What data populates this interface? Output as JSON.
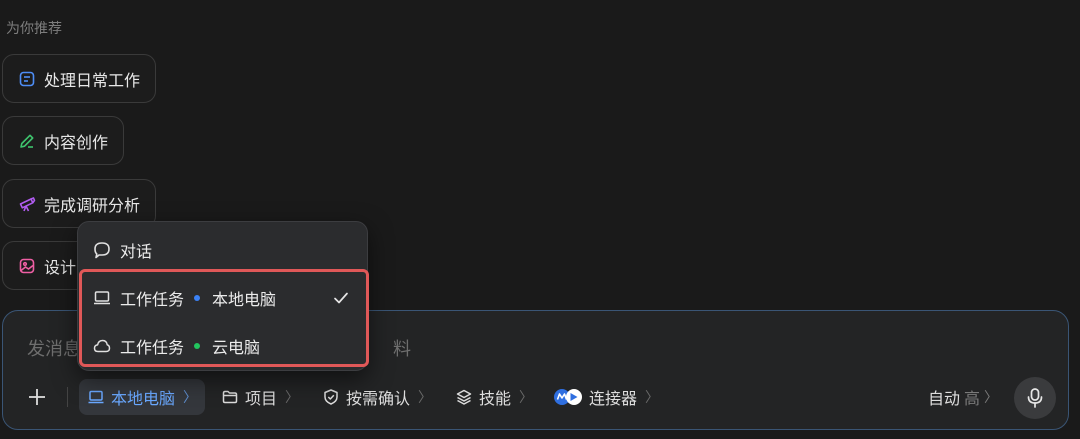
{
  "recommend": {
    "label": "为你推荐",
    "chips": [
      {
        "label": "处理日常工作",
        "icon": "checklist-icon",
        "color": "#4e8ef7"
      },
      {
        "label": "内容创作",
        "icon": "pen-icon",
        "color": "#3ec46d"
      },
      {
        "label": "完成调研分析",
        "icon": "telescope-icon",
        "color": "#b05cf0"
      },
      {
        "label": "设计",
        "icon": "image-icon",
        "color": "#ef5fa4"
      }
    ]
  },
  "menu": {
    "items": [
      {
        "label": "对话",
        "icon": "chat-bubble-icon"
      },
      {
        "label": "工作任务",
        "sublabel": "本地电脑",
        "icon": "laptop-icon",
        "dot_color": "#3b82f6",
        "selected": true
      },
      {
        "label": "工作任务",
        "sublabel": "云电脑",
        "icon": "cloud-icon",
        "dot_color": "#22c55e",
        "selected": false
      }
    ],
    "highlight_color": "#e05858"
  },
  "composer": {
    "placeholder_left": "发消息",
    "placeholder_right": "料",
    "toolbar": {
      "plus_icon": "plus-icon",
      "local_pc": {
        "label": "本地电脑",
        "chevron": "〉"
      },
      "project": {
        "label": "项目",
        "chevron": "〉"
      },
      "confirm": {
        "label": "按需确认",
        "chevron": "〉"
      },
      "skills": {
        "label": "技能",
        "chevron": "〉"
      },
      "connectors": {
        "label": "连接器",
        "chevron": "〉"
      },
      "auto": {
        "label": "自动",
        "level": "高",
        "chevron": "〉"
      },
      "mic_icon": "microphone-icon"
    },
    "accent": "#6aa8ff",
    "border_color": "#3a5575"
  }
}
